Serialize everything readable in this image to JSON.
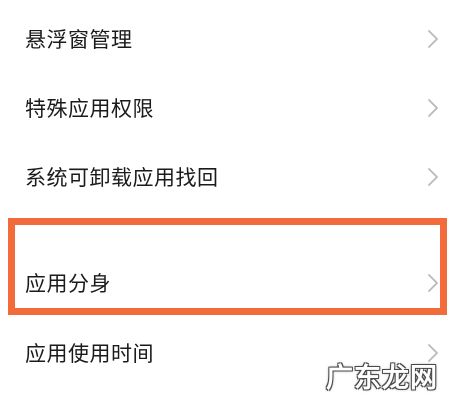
{
  "settings_list": {
    "items": [
      {
        "label": "悬浮窗管理",
        "chevron_icon": "chevron-right-icon"
      },
      {
        "label": "特殊应用权限",
        "chevron_icon": "chevron-right-icon"
      },
      {
        "label": "系统可卸载应用找回",
        "chevron_icon": "chevron-right-icon"
      },
      {
        "label": "应用分身",
        "chevron_icon": "chevron-right-icon",
        "highlighted": true
      },
      {
        "label": "应用使用时间",
        "chevron_icon": "chevron-right-icon"
      }
    ]
  },
  "highlight_color": "#f26b3a",
  "watermark": {
    "text": "广东龙网"
  }
}
